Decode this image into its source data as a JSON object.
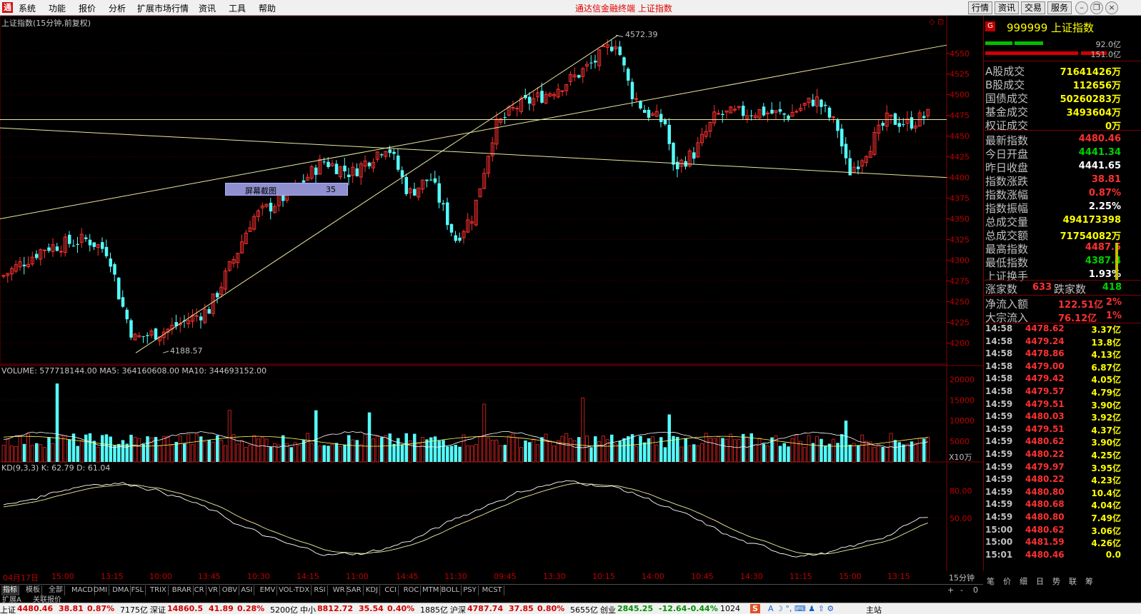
{
  "menubar": {
    "logo": "通",
    "items": [
      "系统",
      "功能",
      "报价",
      "分析",
      "扩展市场行情",
      "资讯",
      "工具",
      "帮助"
    ],
    "title": "通达信金融终端   上证指数",
    "right_buttons": [
      "行情",
      "资讯",
      "交易",
      "服务"
    ]
  },
  "chart": {
    "title": "上证指数(15分钟,前复权)",
    "high_label": "4572.39",
    "low_label": "4188.57",
    "tooltip_label": "屏幕截图",
    "tooltip_value": "35",
    "volume_title": "VOLUME: 577718144.00  MA5: 364160608.00  MA10: 344693152.00",
    "volume_unit": "X10万",
    "kd_title": "KD(9,3,3)  K: 62.79  D: 61.04",
    "period_label": "15分钟",
    "date_labels": [
      "04月17日",
      "15:00",
      "13:15",
      "10:00",
      "13:45",
      "10:30",
      "14:15",
      "11:00",
      "14:45",
      "11:30",
      "09:45",
      "13:30",
      "10:15",
      "14:00",
      "10:45",
      "14:30",
      "11:15",
      "15:00",
      "13:15"
    ]
  },
  "chart_data": {
    "type": "candlestick",
    "price_axis": {
      "ticks": [
        4550,
        4525,
        4500,
        4475,
        4450,
        4425,
        4400,
        4375,
        4350,
        4325,
        4300,
        4275,
        4250,
        4225,
        4200
      ],
      "range": [
        4190,
        4580
      ]
    },
    "volume_axis": {
      "ticks": [
        20000,
        15000,
        10000,
        5000
      ]
    },
    "kd_axis": {
      "ticks": [
        80.0,
        50.0
      ]
    },
    "high": 4572.39,
    "low": 4188.57
  },
  "info": {
    "code": "999999 上证指数",
    "bar1_val": "92.0亿",
    "bar2_val": "151.0亿",
    "rows1": [
      {
        "label": "A股成交",
        "value": "71641426万",
        "color": "yellow"
      },
      {
        "label": "B股成交",
        "value": "112656万",
        "color": "yellow"
      },
      {
        "label": "国债成交",
        "value": "50260283万",
        "color": "yellow"
      },
      {
        "label": "基金成交",
        "value": "3493604万",
        "color": "yellow"
      },
      {
        "label": "权证成交",
        "value": "0万",
        "color": "yellow"
      }
    ],
    "rows2": [
      {
        "label": "最新指数",
        "value": "4480.46",
        "color": "red"
      },
      {
        "label": "今日开盘",
        "value": "4441.34",
        "color": "green"
      },
      {
        "label": "昨日收盘",
        "value": "4441.65",
        "color": "white"
      },
      {
        "label": "指数涨跌",
        "value": "38.81",
        "color": "red"
      },
      {
        "label": "指数涨幅",
        "value": "0.87%",
        "color": "red"
      },
      {
        "label": "指数振幅",
        "value": "2.25%",
        "color": "white"
      },
      {
        "label": "总成交量",
        "value": "494173398",
        "color": "yellow"
      },
      {
        "label": "总成交额",
        "value": "71754082万",
        "color": "yellow"
      },
      {
        "label": "最高指数",
        "value": "4487.5",
        "color": "red"
      },
      {
        "label": "最低指数",
        "value": "4387.4",
        "color": "green"
      },
      {
        "label": "上证换手",
        "value": "1.93%",
        "color": "white"
      }
    ],
    "up_label": "涨家数",
    "up_value": "633",
    "down_label": "跌家数",
    "down_value": "418",
    "flow": [
      {
        "label": "净流入额",
        "value": "122.51亿",
        "pct": "2%"
      },
      {
        "label": "大宗流入",
        "value": "76.12亿",
        "pct": "1%"
      }
    ],
    "ticks": [
      {
        "t": "14:58",
        "p": "4478.62",
        "v": "3.37亿"
      },
      {
        "t": "14:58",
        "p": "4479.24",
        "v": "13.8亿"
      },
      {
        "t": "14:58",
        "p": "4478.86",
        "v": "4.13亿"
      },
      {
        "t": "14:58",
        "p": "4479.00",
        "v": "6.87亿"
      },
      {
        "t": "14:58",
        "p": "4479.42",
        "v": "4.05亿"
      },
      {
        "t": "14:58",
        "p": "4479.57",
        "v": "4.79亿"
      },
      {
        "t": "14:59",
        "p": "4479.51",
        "v": "3.90亿"
      },
      {
        "t": "14:59",
        "p": "4480.03",
        "v": "3.92亿"
      },
      {
        "t": "14:59",
        "p": "4479.51",
        "v": "4.37亿"
      },
      {
        "t": "14:59",
        "p": "4480.62",
        "v": "3.90亿"
      },
      {
        "t": "14:59",
        "p": "4480.22",
        "v": "4.25亿"
      },
      {
        "t": "14:59",
        "p": "4479.97",
        "v": "3.95亿"
      },
      {
        "t": "14:59",
        "p": "4480.22",
        "v": "4.23亿"
      },
      {
        "t": "14:59",
        "p": "4480.80",
        "v": "10.4亿"
      },
      {
        "t": "14:59",
        "p": "4480.68",
        "v": "4.04亿"
      },
      {
        "t": "14:59",
        "p": "4480.80",
        "v": "7.49亿"
      },
      {
        "t": "15:00",
        "p": "4480.62",
        "v": "3.06亿"
      },
      {
        "t": "15:00",
        "p": "4481.59",
        "v": "4.26亿"
      },
      {
        "t": "15:01",
        "p": "4480.46",
        "v": "0.0"
      }
    ],
    "bottom_tabs": [
      "笔",
      "价",
      "细",
      "日",
      "势",
      "联",
      "筹"
    ]
  },
  "indicator_tabs": [
    "指标",
    "模板",
    "全部",
    "MACD",
    "DMI",
    "DMA",
    "FSL",
    "TRIX",
    "BRAR",
    "CR",
    "VR",
    "OBV",
    "ASI",
    "EMV",
    "VOL-TDX",
    "RSI",
    "WR",
    "SAR",
    "KDJ",
    "CCI",
    "ROC",
    "MTM",
    "BOLL",
    "PSY",
    "MCST"
  ],
  "ext_tabs": [
    "扩展A",
    "关联报价"
  ],
  "status": {
    "items": [
      {
        "name": "上证",
        "price": "4480.46",
        "chg": "38.81",
        "pct": "0.87%",
        "amt": "7175亿"
      },
      {
        "name": "深证",
        "price": "14860.5",
        "chg": "41.89",
        "pct": "0.28%",
        "amt": "5200亿"
      },
      {
        "name": "中小",
        "price": "8812.72",
        "chg": "35.54",
        "pct": "0.40%",
        "amt": "1885亿"
      },
      {
        "name": "沪深",
        "price": "4787.74",
        "chg": "37.85",
        "pct": "0.80%",
        "amt": "5655亿"
      },
      {
        "name": "创业",
        "price": "2845.25",
        "chg": "-12.64",
        "pct": "-0.44%",
        "amt": "1024"
      }
    ],
    "right_text": "主站"
  }
}
